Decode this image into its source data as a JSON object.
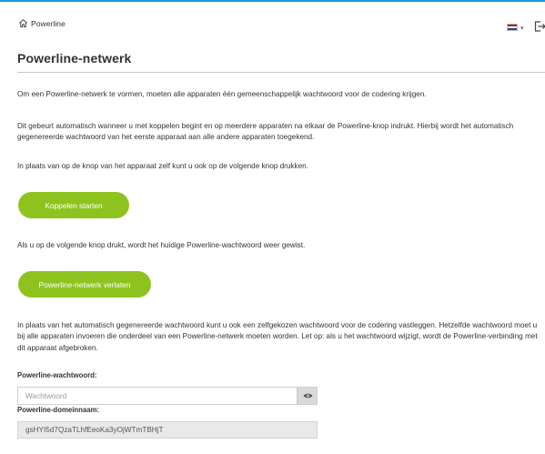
{
  "header": {
    "breadcrumb": "Powerline",
    "language": "nl"
  },
  "page": {
    "title": "Powerline-netwerk"
  },
  "content": {
    "p1": "Om een Powerline-netwerk te vormen, moeten alle apparaten één gemeenschappelijk wachtwoord voor de codering krijgen.",
    "p2": "Dit gebeurt automatisch wanneer u met koppelen begint en op meerdere apparaten na elkaar de Powerline-knop indrukt. Hierbij wordt het automatisch gegenereerde wachtwoord van het eerste apparaat aan alle andere apparaten toegekend.",
    "p3": "In plaats van op de knop van het apparaat zelf kunt u ook op de volgende knop drukken.",
    "p4": "Als u op de volgende knop drukt, wordt het huidige Powerline-wachtwoord weer gewist.",
    "p5": "In plaats van het automatisch gegenereerde wachtwoord kunt u ook een zelfgekozen wachtwoord voor de codering vastleggen. Hetzelfde wachtwoord moet u bij alle apparaten invoeren die onderdeel van een Powerline-netwerk moeten worden. Let op: als u het wachtwoord wijzigt, wordt de Powerline-verbinding met dit apparaat afgebroken."
  },
  "buttons": {
    "pair": "Koppelen starten",
    "leave": "Powerline-netwerk verlaten"
  },
  "fields": {
    "password_label": "Powerline-wachtwoord:",
    "password_placeholder": "Wachtwoord",
    "password_value": "",
    "domain_label": "Powerline-domeinnaam:",
    "domain_value": "gsHYI5d7QzaTLhfEeoKa3yOjWTmTBHjT"
  },
  "colors": {
    "accent_green": "#8ec31f",
    "top_line_blue": "#1a9bd7"
  },
  "icons": [
    "home-icon",
    "flag-nl-icon",
    "chevron-down-icon",
    "logout-icon",
    "eye-icon"
  ]
}
